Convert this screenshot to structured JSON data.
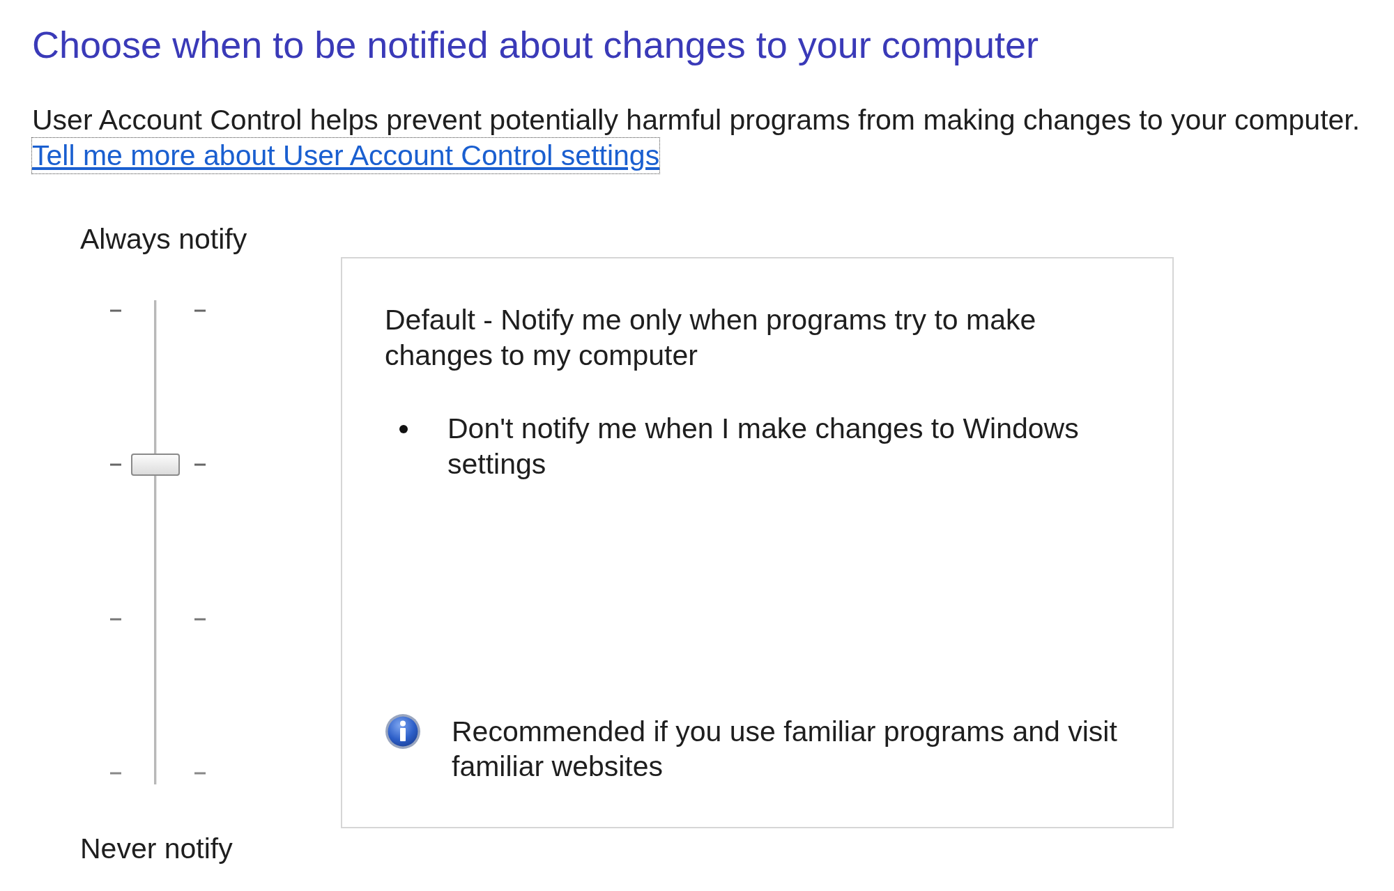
{
  "title": "Choose when to be notified about changes to your computer",
  "description": "User Account Control helps prevent potentially harmful programs from making changes to your computer.",
  "help_link": "Tell me more about User Account Control settings",
  "slider": {
    "top_label": "Always notify",
    "bottom_label": "Never notify",
    "level": 0.667
  },
  "setting_panel": {
    "heading": "Default - Notify me only when programs try to make changes to my computer",
    "bullets": [
      "Don't notify me when I make changes to Windows settings"
    ],
    "note": "Recommended if you use familiar programs and visit familiar websites"
  }
}
